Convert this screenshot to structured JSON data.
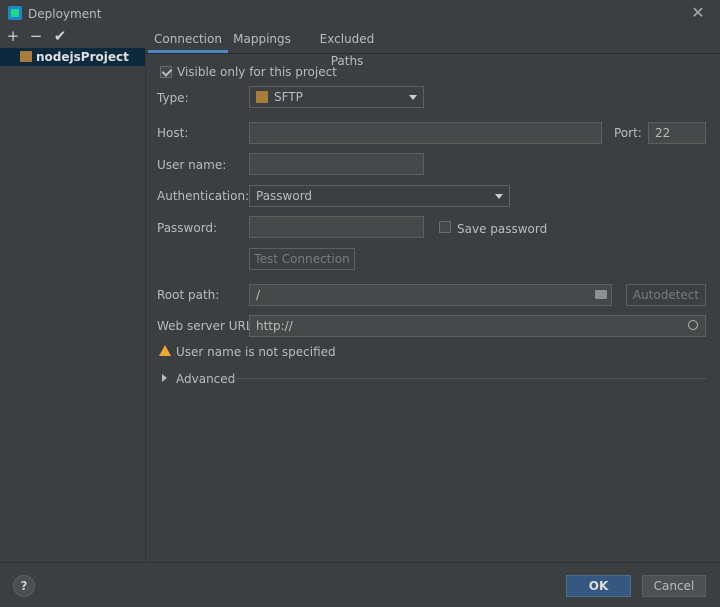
{
  "window": {
    "title": "Deployment"
  },
  "toolbar": {
    "add": "+",
    "remove": "−",
    "apply": "✔"
  },
  "servers": [
    {
      "label": "nodejsProject"
    }
  ],
  "tabs": [
    {
      "label": "Connection"
    },
    {
      "label": "Mappings"
    },
    {
      "label": "Excluded Paths"
    }
  ],
  "form": {
    "visible_only_label": "Visible only for this project",
    "type_label": "Type:",
    "type_value": "SFTP",
    "host_label": "Host:",
    "host_value": "",
    "port_label": "Port:",
    "port_value": "22",
    "username_label": "User name:",
    "username_value": "",
    "auth_label": "Authentication:",
    "auth_value": "Password",
    "password_label": "Password:",
    "password_value": "",
    "save_password_label": "Save password",
    "test_connection_label": "Test Connection",
    "root_path_label": "Root path:",
    "root_path_value": "/",
    "autodetect_label": "Autodetect",
    "web_url_label": "Web server URL:",
    "web_url_value": "http://",
    "warning_text": "User name is not specified",
    "advanced_label": "Advanced"
  },
  "footer": {
    "help": "?",
    "ok": "OK",
    "cancel": "Cancel"
  },
  "colors": {
    "accent": "#365880",
    "warning": "#f0a732",
    "selection": "#0d293e"
  }
}
